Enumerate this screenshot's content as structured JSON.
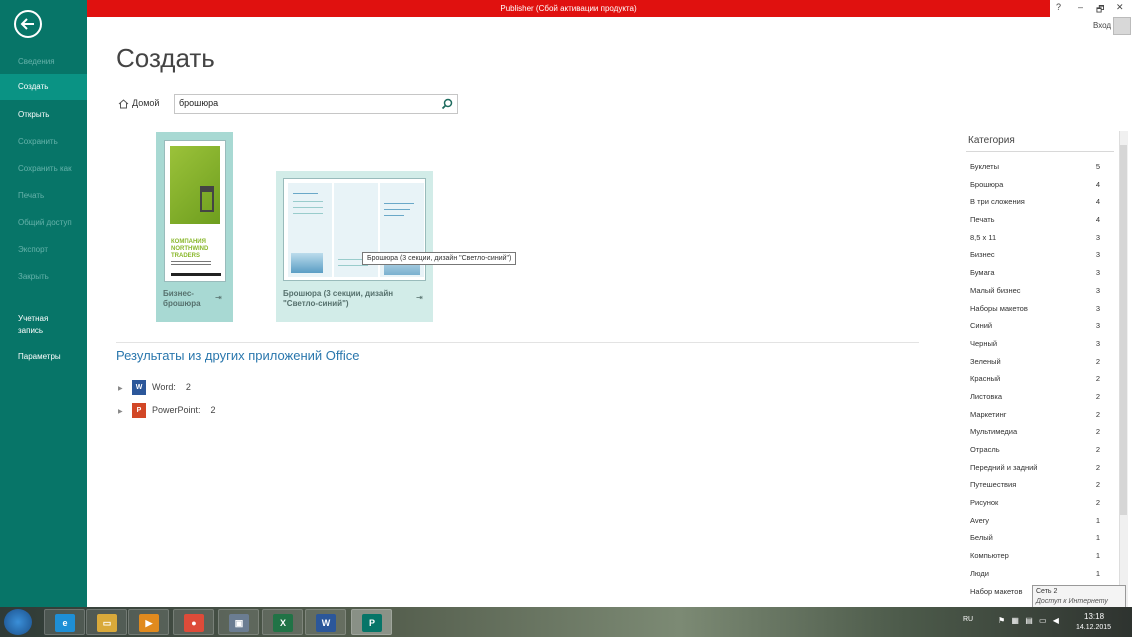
{
  "window": {
    "title": "Publisher (Сбой активации продукта)",
    "help": "?",
    "minimize": "–",
    "restore": "🗗",
    "close": "✕",
    "sign_in": "Вход"
  },
  "sidebar": {
    "items": [
      {
        "label": "Сведения",
        "state": "disabled"
      },
      {
        "label": "Создать",
        "state": "selected"
      },
      {
        "label": "Открыть",
        "state": "enabled"
      },
      {
        "label": "Сохранить",
        "state": "disabled"
      },
      {
        "label": "Сохранить как",
        "state": "disabled"
      },
      {
        "label": "Печать",
        "state": "disabled"
      },
      {
        "label": "Общий доступ",
        "state": "disabled"
      },
      {
        "label": "Экспорт",
        "state": "disabled"
      },
      {
        "label": "Закрыть",
        "state": "disabled"
      },
      {
        "label": "Учетная запись",
        "state": "enabled"
      },
      {
        "label": "Параметры",
        "state": "enabled"
      }
    ]
  },
  "main": {
    "title": "Создать",
    "home_label": "Домой",
    "search": {
      "value": "брошюра"
    },
    "templates": [
      {
        "label": "Бизнес-брошюра",
        "thumb_text": "КОМПАНИЯ NORTHWIND TRADERS"
      },
      {
        "label": "Брошюра (3 секции, дизайн \"Светло-синий\")",
        "tooltip": "Брошюра (3 секции, дизайн \"Светло-синий\")"
      }
    ],
    "other_results_title": "Результаты из других приложений Office",
    "other_apps": [
      {
        "name": "Word:",
        "count": "2",
        "icon": "word-icon",
        "color": "#2b579a",
        "letter": "W"
      },
      {
        "name": "PowerPoint:",
        "count": "2",
        "icon": "powerpoint-icon",
        "color": "#d24726",
        "letter": "P"
      }
    ]
  },
  "categories": {
    "title": "Категория",
    "items": [
      {
        "name": "Буклеты",
        "count": "5"
      },
      {
        "name": "Брошюра",
        "count": "4"
      },
      {
        "name": "В три сложения",
        "count": "4"
      },
      {
        "name": "Печать",
        "count": "4"
      },
      {
        "name": "8,5 x 11",
        "count": "3"
      },
      {
        "name": "Бизнес",
        "count": "3"
      },
      {
        "name": "Бумага",
        "count": "3"
      },
      {
        "name": "Малый бизнес",
        "count": "3"
      },
      {
        "name": "Наборы макетов",
        "count": "3"
      },
      {
        "name": "Синий",
        "count": "3"
      },
      {
        "name": "Черный",
        "count": "3"
      },
      {
        "name": "Зеленый",
        "count": "2"
      },
      {
        "name": "Красный",
        "count": "2"
      },
      {
        "name": "Листовка",
        "count": "2"
      },
      {
        "name": "Маркетинг",
        "count": "2"
      },
      {
        "name": "Мультимедиа",
        "count": "2"
      },
      {
        "name": "Отрасль",
        "count": "2"
      },
      {
        "name": "Передний и задний",
        "count": "2"
      },
      {
        "name": "Путешествия",
        "count": "2"
      },
      {
        "name": "Рисунок",
        "count": "2"
      },
      {
        "name": "Avery",
        "count": "1"
      },
      {
        "name": "Белый",
        "count": "1"
      },
      {
        "name": "Компьютер",
        "count": "1"
      },
      {
        "name": "Люди",
        "count": "1"
      },
      {
        "name": "Набор макетов",
        "count": ""
      }
    ]
  },
  "network_tooltip": {
    "title": "Сеть 2",
    "subtitle": "Доступ к Интернету"
  },
  "taskbar": {
    "lang": "RU",
    "time": "13:18",
    "date": "14.12.2015",
    "apps": [
      {
        "name": "internet-explorer",
        "glyph": "e",
        "color": "#1e8fd6"
      },
      {
        "name": "file-explorer",
        "glyph": "▭",
        "color": "#d9a93a"
      },
      {
        "name": "media-player",
        "glyph": "▶",
        "color": "#e08a1e"
      },
      {
        "name": "chrome",
        "glyph": "●",
        "color": "#dd4b39"
      },
      {
        "name": "screenshot-tool",
        "glyph": "▣",
        "color": "#6b7d92"
      },
      {
        "name": "excel",
        "glyph": "X",
        "color": "#217346"
      },
      {
        "name": "word",
        "glyph": "W",
        "color": "#2b579a"
      },
      {
        "name": "publisher",
        "glyph": "P",
        "color": "#077568"
      }
    ]
  },
  "colors": {
    "accent": "#077568",
    "title_bar": "#e0110f",
    "link": "#2a77ad"
  }
}
